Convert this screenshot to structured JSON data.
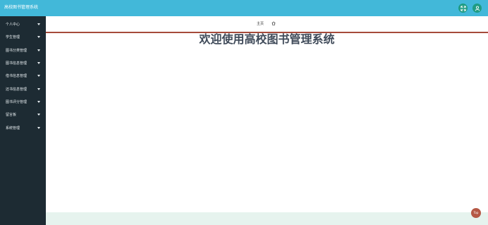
{
  "header": {
    "title": "高校图书管理系统",
    "fullscreen_icon": "fullscreen-icon",
    "user_icon": "user-icon",
    "button_color": "#1f9c83"
  },
  "sidebar": {
    "items": [
      {
        "label": "个人中心"
      },
      {
        "label": "学生管理"
      },
      {
        "label": "图书分类管理"
      },
      {
        "label": "图书信息管理"
      },
      {
        "label": "借书信息管理"
      },
      {
        "label": "还书信息管理"
      },
      {
        "label": "图书评分管理"
      },
      {
        "label": "留言板"
      },
      {
        "label": "系统管理"
      }
    ]
  },
  "breadcrumb": {
    "home_label": "主页",
    "icon": "home-icon"
  },
  "main": {
    "welcome_text": "欢迎使用高校图书管理系统"
  },
  "back_to_top": {
    "label": "Top"
  },
  "colors": {
    "header_bg": "#42b8d9",
    "sidebar_bg": "#1d2b33",
    "accent_line": "#a64a3a",
    "top_button": "#b55845"
  }
}
